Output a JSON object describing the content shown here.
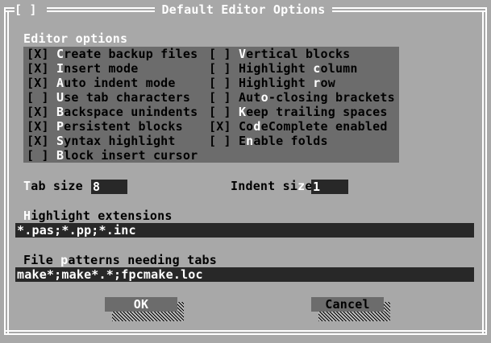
{
  "dialog": {
    "close_box": "[ ]",
    "title": "Default Editor Options"
  },
  "editor_options": {
    "label_hot": "E",
    "label_rest": "ditor options",
    "left": [
      {
        "box": "[X]",
        "pre": "",
        "hot": "C",
        "post": "reate backup files"
      },
      {
        "box": "[X]",
        "pre": "",
        "hot": "I",
        "post": "nsert mode"
      },
      {
        "box": "[X]",
        "pre": "",
        "hot": "A",
        "post": "uto indent mode"
      },
      {
        "box": "[ ]",
        "pre": "",
        "hot": "U",
        "post": "se tab characters"
      },
      {
        "box": "[X]",
        "pre": "",
        "hot": "B",
        "post": "ackspace unindents"
      },
      {
        "box": "[X]",
        "pre": "",
        "hot": "P",
        "post": "ersistent blocks"
      },
      {
        "box": "[X]",
        "pre": "",
        "hot": "S",
        "post": "yntax highlight"
      },
      {
        "box": "[ ]",
        "pre": "",
        "hot": "B",
        "post": "lock insert cursor"
      }
    ],
    "right": [
      {
        "box": "[ ]",
        "pre": "",
        "hot": "V",
        "post": "ertical blocks"
      },
      {
        "box": "[ ]",
        "pre": "Highlight ",
        "hot": "c",
        "post": "olumn"
      },
      {
        "box": "[ ]",
        "pre": "Highlight ",
        "hot": "r",
        "post": "ow"
      },
      {
        "box": "[ ]",
        "pre": "Aut",
        "hot": "o",
        "post": "-closing brackets"
      },
      {
        "box": "[ ]",
        "pre": "",
        "hot": "K",
        "post": "eep trailing spaces"
      },
      {
        "box": "[X]",
        "pre": "Co",
        "hot": "d",
        "post": "eComplete enabled"
      },
      {
        "box": "[ ]",
        "pre": "E",
        "hot": "n",
        "post": "able folds"
      }
    ]
  },
  "tab_size": {
    "label_hot": "T",
    "label_rest": "ab size",
    "value": "8"
  },
  "indent_size": {
    "label_pre": "Indent si",
    "label_hot": "z",
    "label_rest": "e",
    "value": "1"
  },
  "highlight_extensions": {
    "label_hot": "H",
    "label_rest": "ighlight extensions",
    "value": "*.pas;*.pp;*.inc"
  },
  "file_patterns": {
    "label_pre": "File ",
    "label_hot": "p",
    "label_rest": "atterns needing tabs",
    "value": "make*;make*.*;fpcmake.loc"
  },
  "buttons": {
    "ok": "OK",
    "cancel": "Cancel"
  }
}
